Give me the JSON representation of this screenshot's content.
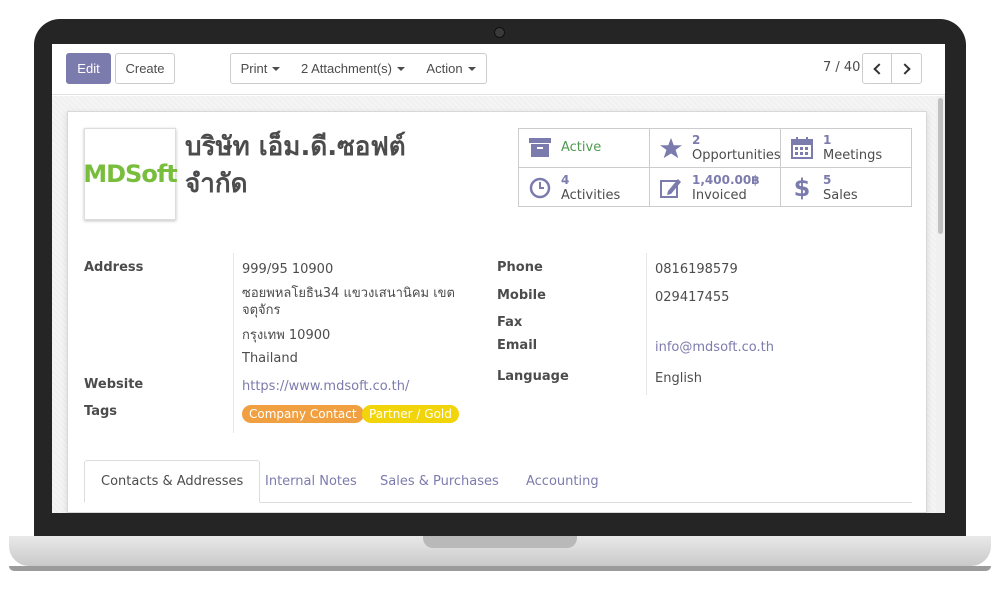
{
  "toolbar": {
    "edit_label": "Edit",
    "create_label": "Create",
    "print_label": "Print",
    "attachments_label": "2 Attachment(s)",
    "action_label": "Action",
    "pager_text": "7 / 40"
  },
  "partner": {
    "logo_text": "MDSoft",
    "name_line1": "บริษัท เอ็ม.ดี.ซอฟต์",
    "name_line2": "จำกัด"
  },
  "stats": {
    "active": "Active",
    "opportunities_count": "2",
    "opportunities_label": "Opportunities",
    "meetings_count": "1",
    "meetings_label": "Meetings",
    "activities_count": "4",
    "activities_label": "Activities",
    "invoiced_amount": "1,400.00฿",
    "invoiced_label": "Invoiced",
    "sales_count": "5",
    "sales_label": "Sales"
  },
  "fields": {
    "address_label": "Address",
    "address_line1": "999/95 10900",
    "address_line2": "ซอยพหลโยธิน34 แขวงเสนานิคม เขต",
    "address_line3": "จตุจักร",
    "address_line4": "กรุงเทพ 10900",
    "address_line5": "Thailand",
    "website_label": "Website",
    "website_value": "https://www.mdsoft.co.th/",
    "tags_label": "Tags",
    "tags": [
      "Company Contact",
      "Partner / Gold"
    ],
    "phone_label": "Phone",
    "phone_value": "0816198579",
    "mobile_label": "Mobile",
    "mobile_value": "029417455",
    "fax_label": "Fax",
    "email_label": "Email",
    "email_value": "info@mdsoft.co.th",
    "language_label": "Language",
    "language_value": "English"
  },
  "tabs": [
    "Contacts & Addresses",
    "Internal Notes",
    "Sales & Purchases",
    "Accounting"
  ],
  "colors": {
    "primary": "#7c7bad",
    "tag_company_contact": "#f0a041",
    "tag_partner_gold": "#f2d40a",
    "active_green": "#4e9a4e"
  }
}
